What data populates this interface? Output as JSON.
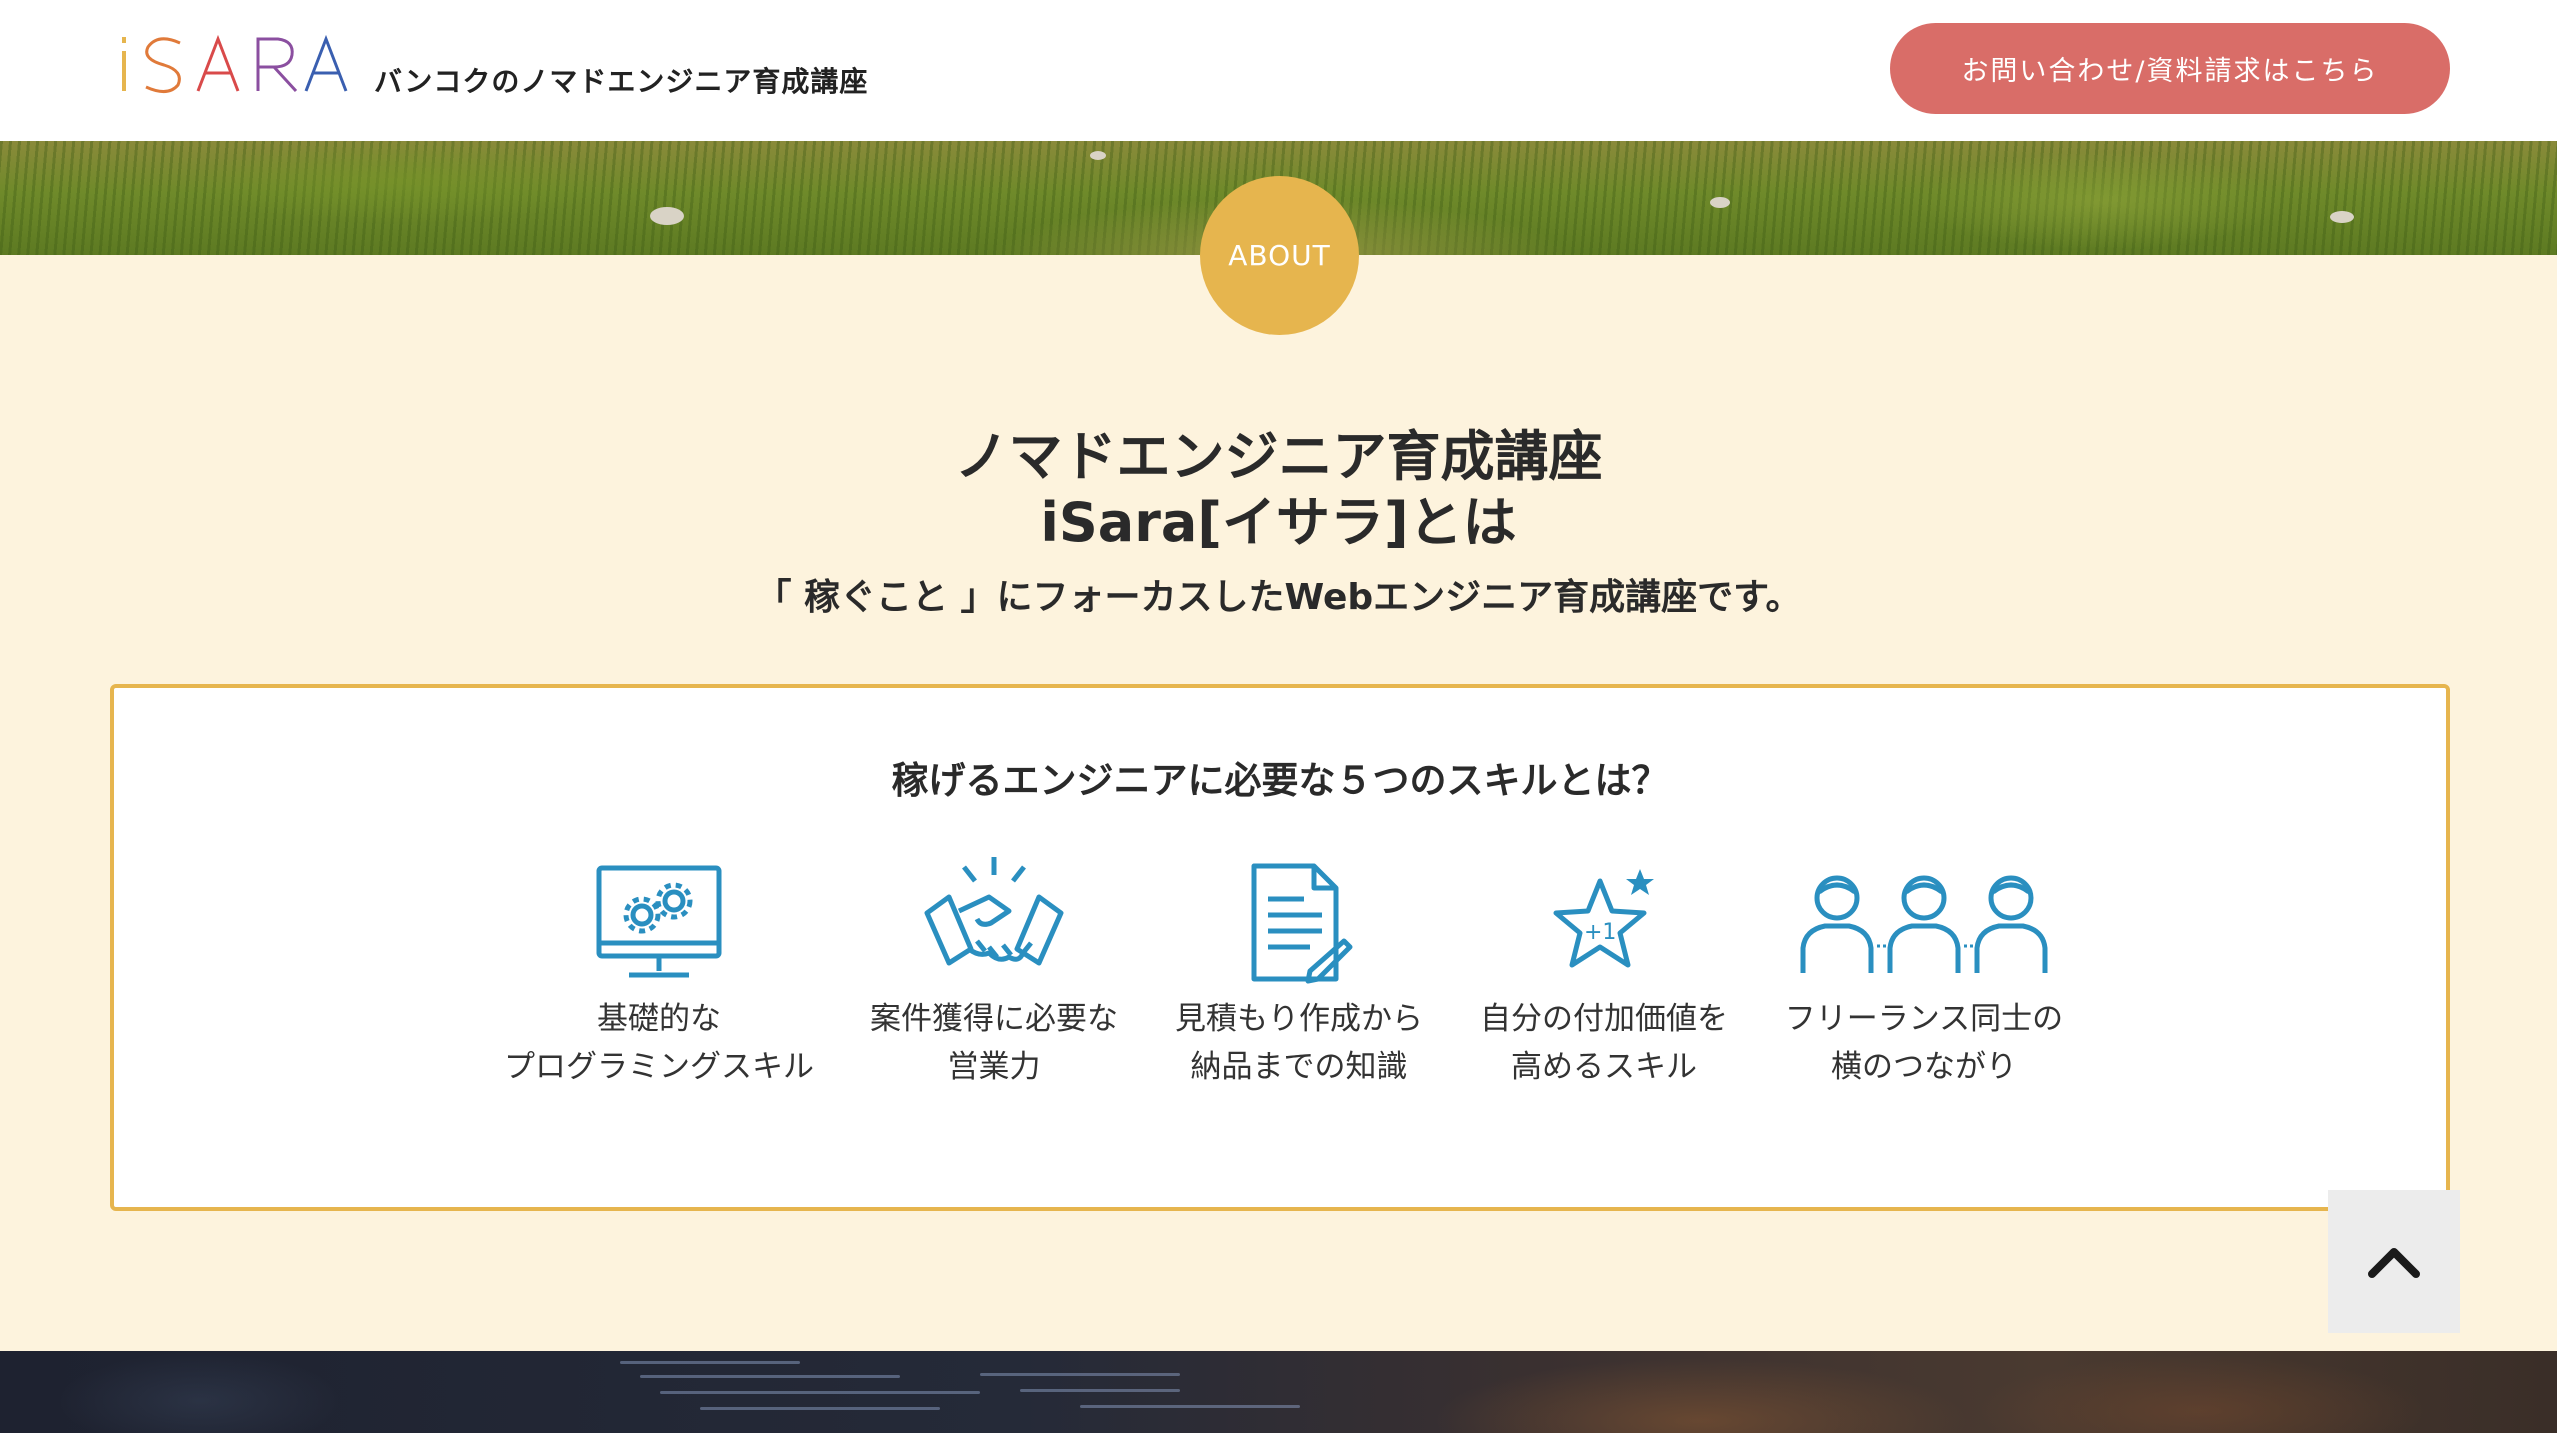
{
  "header": {
    "logo_text": "iSARA",
    "tagline": "バンコクのノマドエンジニア育成講座",
    "contact_button": "お問い合わせ/資料請求はこちら"
  },
  "about": {
    "badge": "ABOUT",
    "title_line1": "ノマドエンジニア育成講座",
    "title_line2": "iSara[イサラ]とは",
    "subtitle": "「 稼ぐこと 」にフォーカスしたWebエンジニア育成講座です。"
  },
  "skills": {
    "title": "稼げるエンジニアに必要な５つのスキルとは？",
    "items": [
      {
        "icon": "monitor-gears-icon",
        "line1": "基礎的な",
        "line2": "プログラミングスキル"
      },
      {
        "icon": "handshake-icon",
        "line1": "案件獲得に必要な",
        "line2": "営業力"
      },
      {
        "icon": "document-pen-icon",
        "line1": "見積もり作成から",
        "line2": "納品までの知識"
      },
      {
        "icon": "star-plus-one-icon",
        "line1": "自分の付加価値を",
        "line2": "高めるスキル"
      },
      {
        "icon": "people-network-icon",
        "line1": "フリーランス同士の",
        "line2": "横のつながり"
      }
    ]
  },
  "colors": {
    "accent_gold": "#e6b54e",
    "contact_red": "#d96d68",
    "icon_blue": "#2a8fc0",
    "page_bg": "#fdf3dd"
  },
  "back_to_top": {
    "icon": "chevron-up-icon"
  }
}
